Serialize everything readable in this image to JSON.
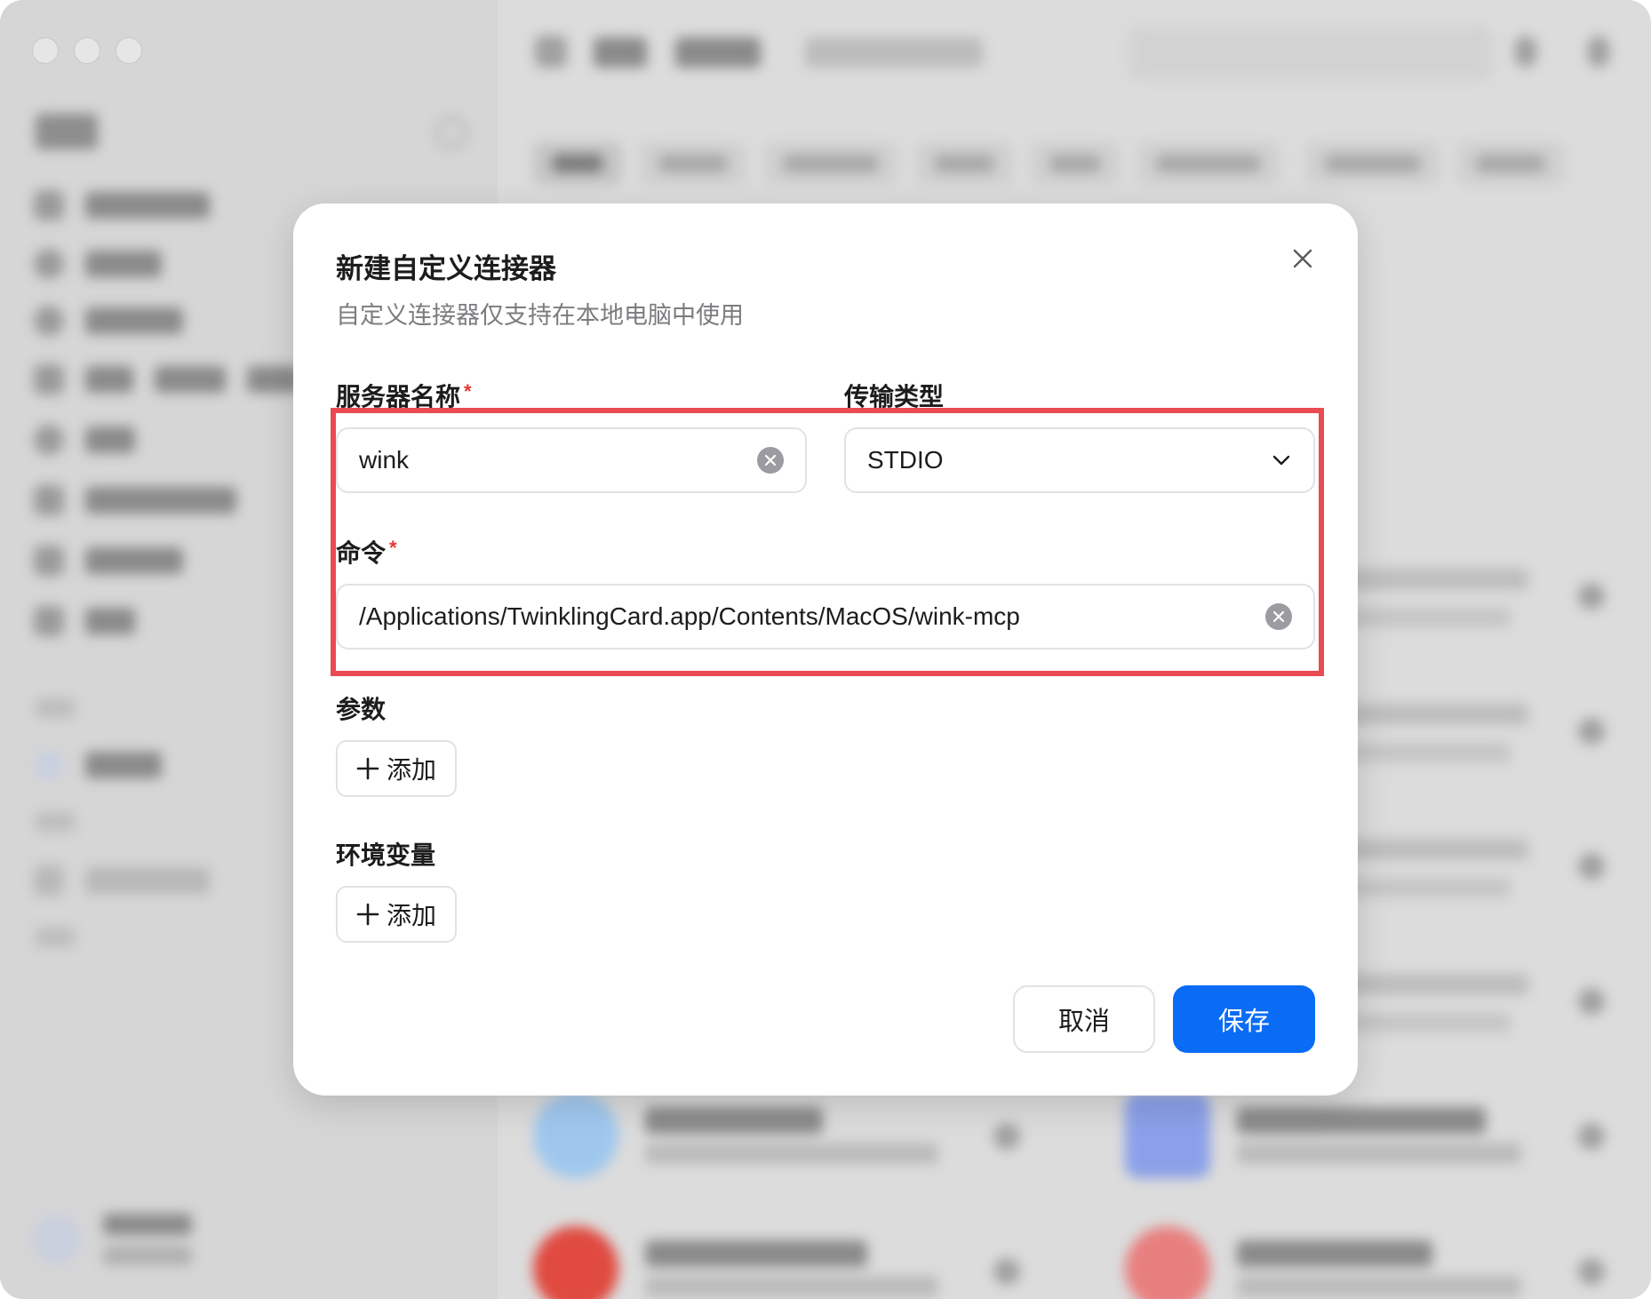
{
  "dialog": {
    "title": "新建自定义连接器",
    "subtitle": "自定义连接器仅支持在本地电脑中使用",
    "server_name": {
      "label": "服务器名称",
      "required_mark": "*",
      "value": "wink"
    },
    "transport_type": {
      "label": "传输类型",
      "value": "STDIO"
    },
    "command": {
      "label": "命令",
      "required_mark": "*",
      "value": "/Applications/TwinklingCard.app/Contents/MacOS/wink-mcp"
    },
    "args": {
      "label": "参数",
      "add_label": "添加"
    },
    "env": {
      "label": "环境变量",
      "add_label": "添加"
    },
    "cancel_label": "取消",
    "save_label": "保存"
  },
  "colors": {
    "primary": "#0a6cf5",
    "highlight_border": "#ea4b52",
    "required": "#e53935"
  },
  "icons": [
    "close-icon",
    "clear-icon",
    "chevron-down-icon",
    "plus-icon"
  ]
}
